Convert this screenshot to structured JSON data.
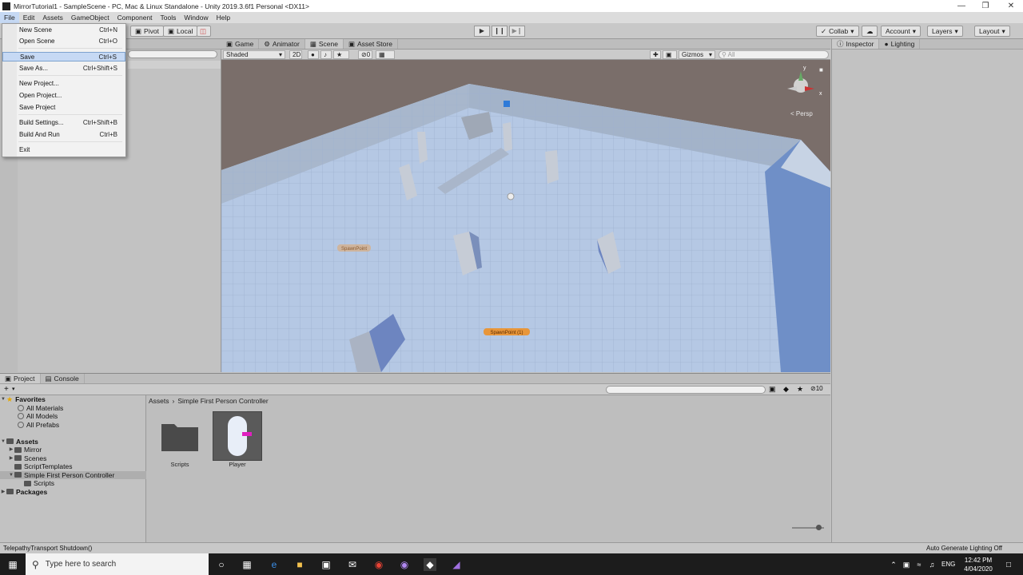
{
  "window": {
    "title": "MirrorTutorial1 - SampleScene - PC, Mac & Linux Standalone - Unity 2019.3.6f1 Personal <DX11>"
  },
  "menubar": [
    "File",
    "Edit",
    "Assets",
    "GameObject",
    "Component",
    "Tools",
    "Window",
    "Help"
  ],
  "file_menu": [
    {
      "label": "New Scene",
      "shortcut": "Ctrl+N"
    },
    {
      "label": "Open Scene",
      "shortcut": "Ctrl+O"
    },
    {
      "label": "Save",
      "shortcut": "Ctrl+S"
    },
    {
      "label": "Save As...",
      "shortcut": "Ctrl+Shift+S"
    },
    {
      "label": "New Project...",
      "shortcut": ""
    },
    {
      "label": "Open Project...",
      "shortcut": ""
    },
    {
      "label": "Save Project",
      "shortcut": ""
    },
    {
      "label": "Build Settings...",
      "shortcut": "Ctrl+Shift+B"
    },
    {
      "label": "Build And Run",
      "shortcut": "Ctrl+B"
    },
    {
      "label": "Exit",
      "shortcut": ""
    }
  ],
  "toolbar": {
    "pivot": "Pivot",
    "local": "Local",
    "collab": "Collab",
    "account": "Account",
    "layers": "Layers",
    "layout": "Layout"
  },
  "scene_tabs": [
    "Game",
    "Animator",
    "Scene",
    "Asset Store"
  ],
  "scene_toolbar": {
    "shading": "Shaded",
    "mode2d": "2D",
    "fx_count": "0",
    "gizmos": "Gizmos",
    "search_placeholder": "All"
  },
  "scene": {
    "persp_label": "Persp",
    "spawn1": "SpawnPoint",
    "spawn2": "SpawnPoint (1)",
    "gizmo_axes": [
      "y",
      "x"
    ]
  },
  "inspector_tabs": [
    "Inspector",
    "Lighting"
  ],
  "project_tabs": [
    "Project",
    "Console"
  ],
  "project": {
    "hidden_count": "10",
    "breadcrumb": [
      "Assets",
      "Simple First Person Controller"
    ],
    "favorites_label": "Favorites",
    "favorites": [
      "All Materials",
      "All Models",
      "All Prefabs"
    ],
    "assets_label": "Assets",
    "asset_folders": [
      "Mirror",
      "Scenes",
      "ScriptTemplates",
      "Simple First Person Controller"
    ],
    "sub_folder": "Scripts",
    "packages_label": "Packages",
    "items": [
      {
        "name": "Scripts",
        "kind": "folder"
      },
      {
        "name": "Player",
        "kind": "prefab"
      }
    ]
  },
  "status": {
    "left": "TelepathyTransport Shutdown()",
    "right": "Auto Generate Lighting Off"
  },
  "taskbar": {
    "search_placeholder": "Type here to search",
    "lang": "ENG",
    "time": "12:42 PM",
    "date": "4/04/2020"
  }
}
